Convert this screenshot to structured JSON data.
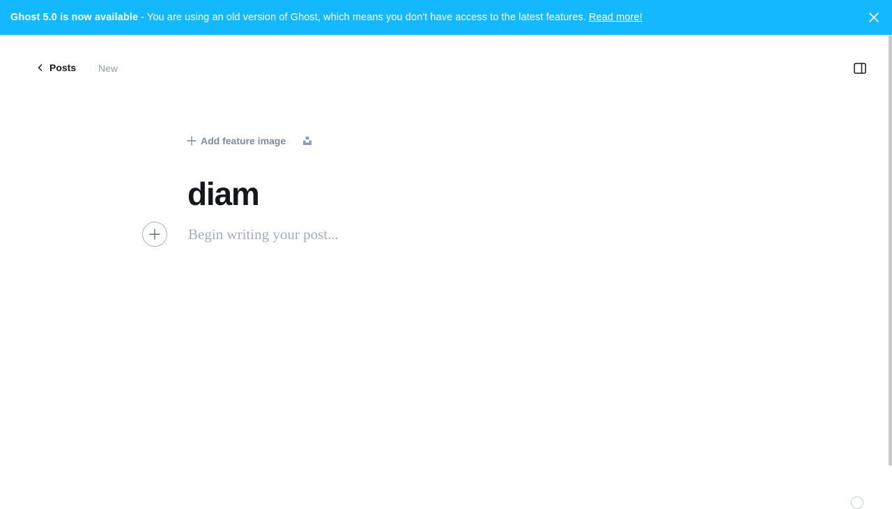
{
  "banner": {
    "title": "Ghost 5.0 is now available",
    "message": "- You are using an old version of Ghost, which means you don't have access to the latest features.",
    "link_text": "Read more!",
    "close_icon": "close-icon",
    "background_color": "#14b8ff"
  },
  "header": {
    "back_label": "Posts",
    "status_label": "New",
    "settings_icon": "sidebar-toggle-icon"
  },
  "editor": {
    "add_feature_image_label": "Add feature image",
    "unsplash_icon": "unsplash-icon",
    "title": "diam",
    "body_placeholder": "Begin writing your post..."
  }
}
